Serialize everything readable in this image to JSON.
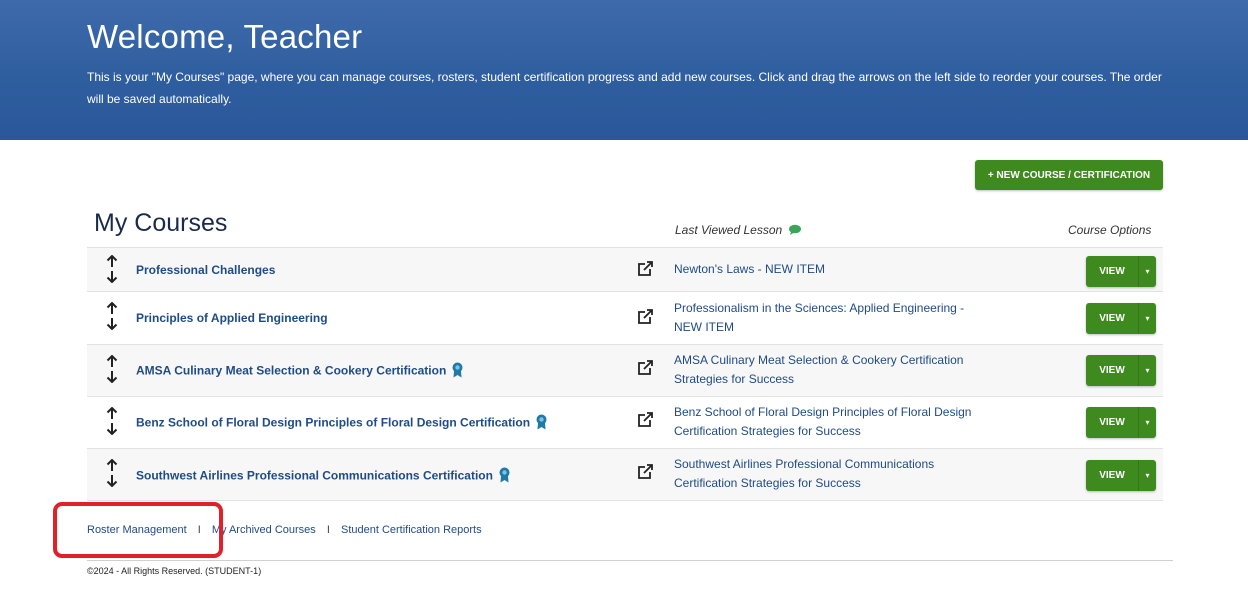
{
  "header": {
    "title": "Welcome, Teacher",
    "description": "This is your \"My Courses\" page, where you can manage courses, rosters, student certification progress and add new courses. Click and drag the arrows on the left side to reorder your courses. The order will be saved automatically."
  },
  "new_course_button": "+ NEW COURSE / CERTIFICATION",
  "section_title": "My Courses",
  "columns": {
    "last_viewed": "Last Viewed Lesson",
    "course_options": "Course Options"
  },
  "courses": [
    {
      "name": "Professional Challenges",
      "certified": false,
      "last_lesson": "Newton's Laws - NEW ITEM",
      "view_label": "VIEW"
    },
    {
      "name": "Principles of Applied Engineering",
      "certified": false,
      "last_lesson": "Professionalism in the Sciences: Applied Engineering - NEW ITEM",
      "view_label": "VIEW"
    },
    {
      "name": "AMSA Culinary Meat Selection & Cookery Certification",
      "certified": true,
      "last_lesson": "AMSA Culinary Meat Selection & Cookery Certification Strategies for Success",
      "view_label": "VIEW"
    },
    {
      "name": "Benz School of Floral Design Principles of Floral Design Certification",
      "certified": true,
      "last_lesson": "Benz School of Floral Design Principles of Floral Design Certification Strategies for Success",
      "view_label": "VIEW"
    },
    {
      "name": "Southwest Airlines Professional Communications Certification",
      "certified": true,
      "last_lesson": "Southwest Airlines Professional Communications Certification Strategies for Success",
      "view_label": "VIEW"
    }
  ],
  "footer": {
    "links": [
      "Roster Management",
      "My Archived Courses",
      "Student Certification Reports"
    ],
    "separator": "I",
    "copyright": "©2024 - All Rights Reserved. (STUDENT-1)"
  },
  "colors": {
    "header_blue": "#2f5e9f",
    "button_green": "#3f8a1f",
    "link_blue": "#1f4b86",
    "highlight_red": "#e0202a",
    "badge_teal": "#1f7aa8"
  }
}
